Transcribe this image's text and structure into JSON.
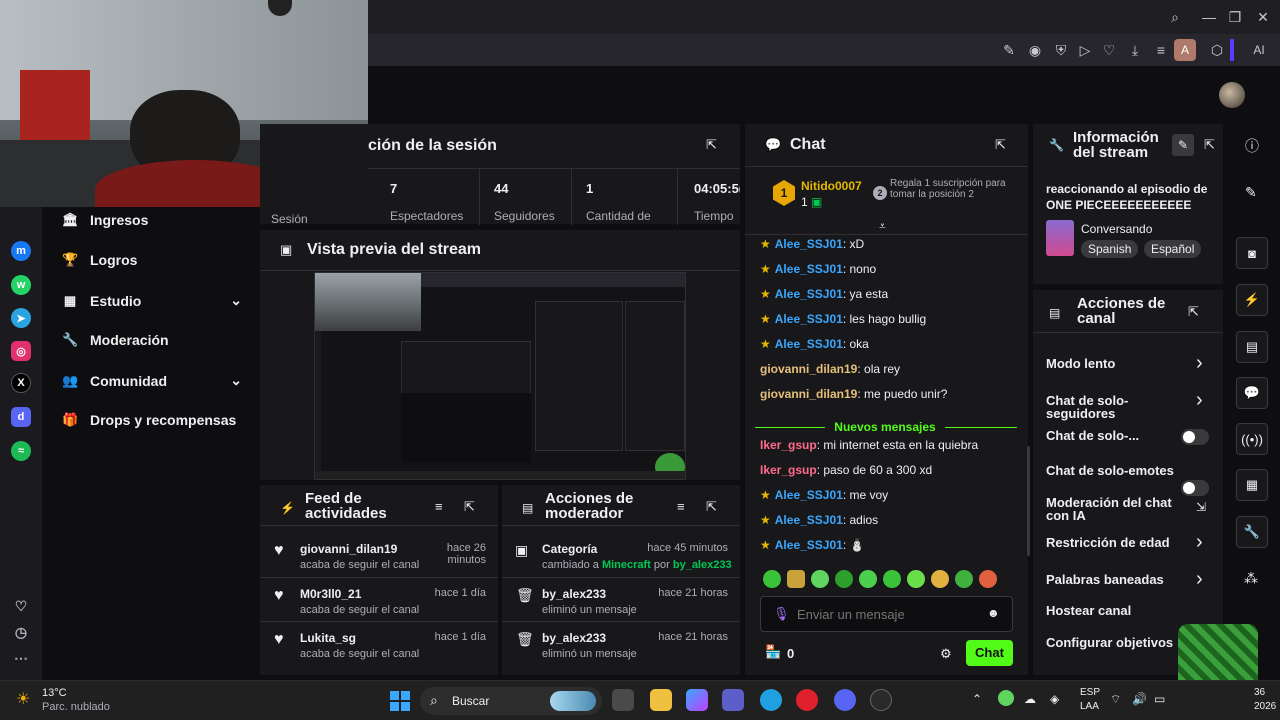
{
  "session": {
    "title": "ción de la sesión",
    "session_label": "Sesión",
    "stats": [
      {
        "value": "7",
        "label": "Espectadores"
      },
      {
        "value": "44",
        "label": "Seguidores"
      },
      {
        "value": "1",
        "label": "Cantidad de"
      },
      {
        "value": "04:05:5(",
        "label": "Tiempo"
      }
    ]
  },
  "nav": {
    "items": [
      {
        "label": "Ingresos",
        "icon": "bank-icon"
      },
      {
        "label": "Logros",
        "icon": "trophy-icon"
      },
      {
        "label": "Estudio",
        "icon": "studio-icon"
      },
      {
        "label": "Moderación",
        "icon": "wrench-icon"
      },
      {
        "label": "Comunidad",
        "icon": "people-icon"
      },
      {
        "label": "Drops y recompensas",
        "icon": "gift-icon"
      }
    ]
  },
  "preview": {
    "title": "Vista previa del stream"
  },
  "feed": {
    "title": "Feed de actividades",
    "items": [
      {
        "user": "giovanni_dilan19",
        "time": "hace 26 minutos",
        "desc": "acaba de seguir el canal"
      },
      {
        "user": "M0r3ll0_21",
        "time": "hace 1 día",
        "desc": "acaba de seguir el canal"
      },
      {
        "user": "Lukita_sg",
        "time": "hace 1 día",
        "desc": "acaba de seguir el canal"
      }
    ]
  },
  "modactions": {
    "title": "Acciones de moderador",
    "items": [
      {
        "title": "Categoría",
        "time": "hace 45 minutos",
        "pre": "cambiado a ",
        "game": "Minecraft",
        "mid": " por ",
        "by": "by_alex233"
      },
      {
        "title": "by_alex233",
        "time": "hace 21 horas",
        "desc": "eliminó un mensaje"
      },
      {
        "title": "by_alex233",
        "time": "hace 21 horas",
        "desc": "eliminó un mensaje"
      }
    ]
  },
  "chat": {
    "title": "Chat",
    "top_user": "Nitido0007",
    "top_count": "1",
    "gift_text": "Regala 1 suscripción para tomar la posición 2",
    "new_messages": "Nuevos mensajes",
    "messages": [
      {
        "user": "Alee_SSJ01",
        "text": ": xD",
        "star": true,
        "color": "#3aa7ff"
      },
      {
        "user": "Alee_SSJ01",
        "text": ": nono",
        "star": true,
        "color": "#3aa7ff"
      },
      {
        "user": "Alee_SSJ01",
        "text": ": ya esta",
        "star": true,
        "color": "#3aa7ff"
      },
      {
        "user": "Alee_SSJ01",
        "text": ": les hago bullig",
        "star": true,
        "color": "#3aa7ff"
      },
      {
        "user": "Alee_SSJ01",
        "text": ": oka",
        "star": true,
        "color": "#3aa7ff"
      },
      {
        "user": "giovanni_dilan19",
        "text": ": ola rey",
        "star": false,
        "color": "#e6c07b"
      },
      {
        "user": "giovanni_dilan19",
        "text": ": me puedo unir?",
        "star": false,
        "color": "#e6c07b"
      },
      {
        "user": "Iker_gsup",
        "text": ": mi internet esta en la quiebra",
        "star": false,
        "color": "#ff6b8a"
      },
      {
        "user": "Iker_gsup",
        "text": ": paso de 60 a 300 xd",
        "star": false,
        "color": "#ff6b8a"
      },
      {
        "user": "Alee_SSJ01",
        "text": ": me voy",
        "star": true,
        "color": "#3aa7ff"
      },
      {
        "user": "Alee_SSJ01",
        "text": ": adios",
        "star": true,
        "color": "#3aa7ff"
      },
      {
        "user": "Alee_SSJ01",
        "text": ": ⛄",
        "star": true,
        "color": "#3aa7ff"
      }
    ],
    "input_placeholder": "Enviar un mensaje",
    "points": "0",
    "send_label": "Chat"
  },
  "info": {
    "title": "Información del stream",
    "stream_title": "reaccionando al episodio de ONE PIECEEEEEEEEEEE",
    "category": "Conversando",
    "tags": [
      "Spanish",
      "Español"
    ]
  },
  "channel": {
    "title": "Acciones de canal",
    "rows": [
      {
        "label": "Modo lento",
        "kind": "chevron"
      },
      {
        "label": "Chat de solo-seguidores",
        "kind": "chevron"
      },
      {
        "label": "Chat de solo-...",
        "kind": "toggle"
      },
      {
        "label": "Chat de solo-emotes",
        "kind": "toggle"
      },
      {
        "label": "Moderación del chat con IA",
        "kind": "external"
      },
      {
        "label": "Restricción de edad",
        "kind": "chevron"
      },
      {
        "label": "Palabras baneadas",
        "kind": "chevron"
      },
      {
        "label": "Hostear canal",
        "kind": "none"
      },
      {
        "label": "Configurar objetivos",
        "kind": "none"
      }
    ]
  },
  "browser": {
    "profile_letter": "A",
    "ai_label": "AI"
  },
  "taskbar": {
    "temp": "13°C",
    "weather": "Parc. nublado",
    "search": "Buscar",
    "lang1": "ESP",
    "lang2": "LAA",
    "time": "36",
    "date": "2026"
  },
  "colors": {
    "accent": "#53fc18",
    "bg": "#0e0e10",
    "panel": "#18181b"
  }
}
